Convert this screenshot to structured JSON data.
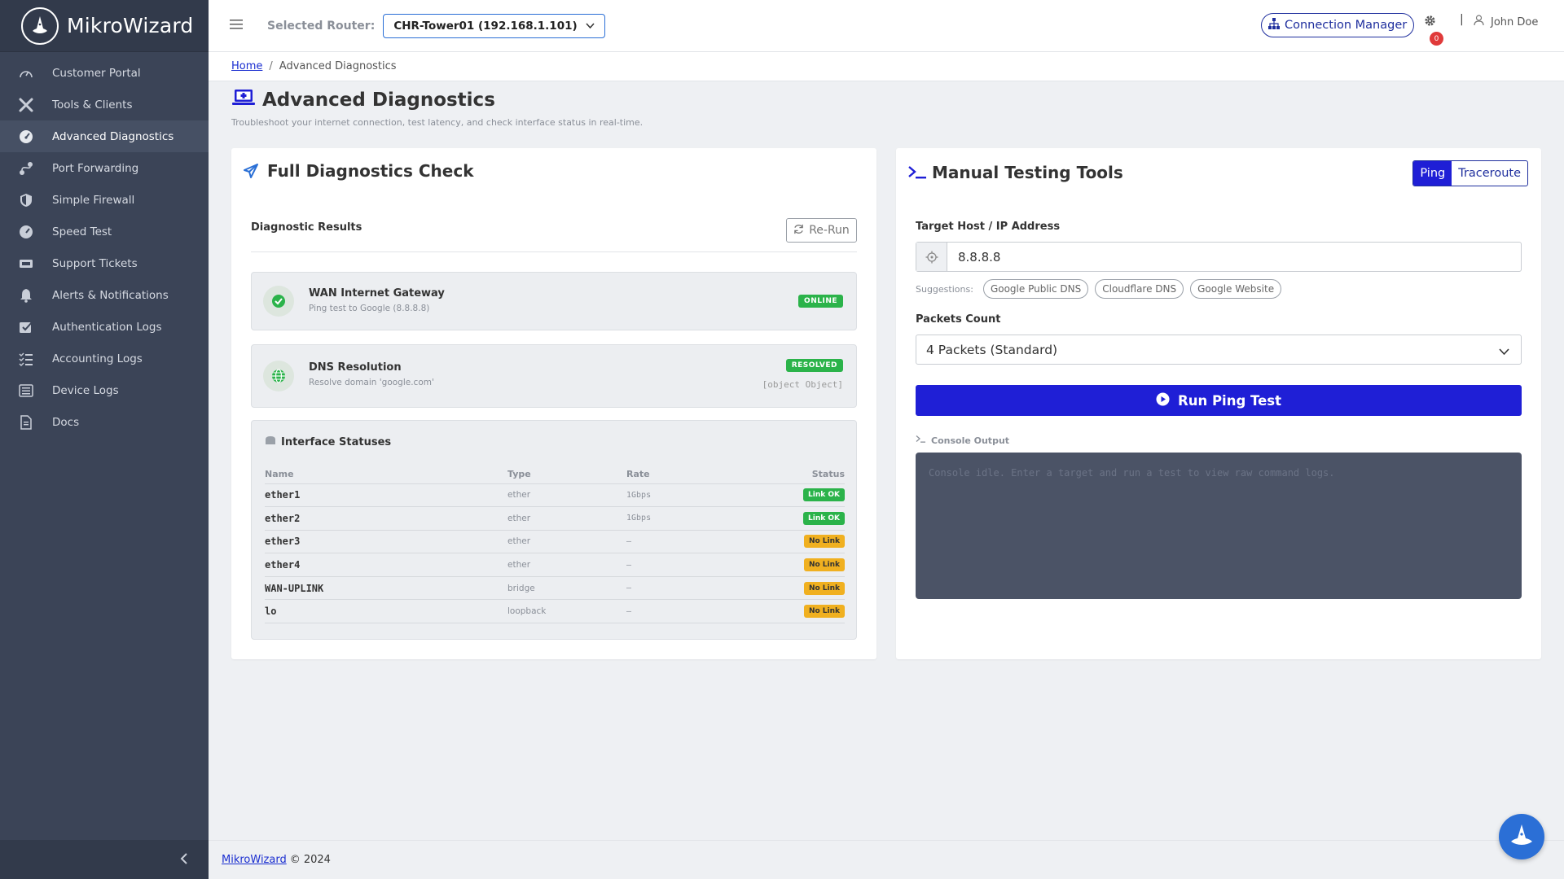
{
  "app": {
    "name": "MikroWizard"
  },
  "sidebar": {
    "items": [
      {
        "label": "Customer Portal",
        "icon": "gauge-icon"
      },
      {
        "label": "Tools & Clients",
        "icon": "tools-icon"
      },
      {
        "label": "Advanced Diagnostics",
        "icon": "speedometer-icon",
        "active": true
      },
      {
        "label": "Port Forwarding",
        "icon": "route-icon"
      },
      {
        "label": "Simple Firewall",
        "icon": "shield-icon"
      },
      {
        "label": "Speed Test",
        "icon": "speed-icon"
      },
      {
        "label": "Support Tickets",
        "icon": "ticket-icon"
      },
      {
        "label": "Alerts & Notifications",
        "icon": "bell-icon"
      },
      {
        "label": "Authentication Logs",
        "icon": "check-square-icon"
      },
      {
        "label": "Accounting Logs",
        "icon": "list-check-icon"
      },
      {
        "label": "Device Logs",
        "icon": "list-icon"
      },
      {
        "label": "Docs",
        "icon": "document-icon"
      }
    ]
  },
  "header": {
    "router_label": "Selected Router:",
    "router_value": "CHR-Tower01 (192.168.1.101)",
    "connection_manager": "Connection Manager",
    "notification_count": "0",
    "separator": "|",
    "user_name": "John Doe"
  },
  "breadcrumb": {
    "home": "Home",
    "separator": "/",
    "current": "Advanced Diagnostics"
  },
  "page": {
    "title": "Advanced Diagnostics",
    "subtitle": "Troubleshoot your internet connection, test latency, and check interface status in real-time."
  },
  "diagnostics": {
    "title": "Full Diagnostics Check",
    "results_label": "Diagnostic Results",
    "rerun_label": "Re-Run",
    "wan": {
      "title": "WAN Internet Gateway",
      "desc": "Ping test to Google (8.8.8.8)",
      "status": "ONLINE"
    },
    "dns": {
      "title": "DNS Resolution",
      "desc": "Resolve domain 'google.com'",
      "status": "RESOLVED",
      "detail": "[object Object]"
    },
    "interfaces": {
      "title": "Interface Statuses",
      "columns": {
        "name": "Name",
        "type": "Type",
        "rate": "Rate",
        "status": "Status"
      },
      "rows": [
        {
          "name": "ether1",
          "type": "ether",
          "rate": "1Gbps",
          "status": "Link OK",
          "ok": true
        },
        {
          "name": "ether2",
          "type": "ether",
          "rate": "1Gbps",
          "status": "Link OK",
          "ok": true
        },
        {
          "name": "ether3",
          "type": "ether",
          "rate": "—",
          "status": "No Link",
          "ok": false
        },
        {
          "name": "ether4",
          "type": "ether",
          "rate": "—",
          "status": "No Link",
          "ok": false
        },
        {
          "name": "WAN-UPLINK",
          "type": "bridge",
          "rate": "—",
          "status": "No Link",
          "ok": false
        },
        {
          "name": "lo",
          "type": "loopback",
          "rate": "—",
          "status": "No Link",
          "ok": false
        }
      ]
    }
  },
  "manual": {
    "title": "Manual Testing Tools",
    "tabs": {
      "ping": "Ping",
      "traceroute": "Traceroute"
    },
    "target_label": "Target Host / IP Address",
    "target_value": "8.8.8.8",
    "suggestions_label": "Suggestions:",
    "suggestions": [
      "Google Public DNS",
      "Cloudflare DNS",
      "Google Website"
    ],
    "packets_label": "Packets Count",
    "packets_value": "4 Packets (Standard)",
    "run_label": "Run Ping Test",
    "console_label": "Console Output",
    "console_placeholder": "Console idle. Enter a target and run a test to view raw command logs."
  },
  "footer": {
    "link": "MikroWizard",
    "text": "© 2024"
  },
  "colors": {
    "accent": "#1f1fd6",
    "sidebar": "#3b4457",
    "success": "#2bb34a",
    "warning": "#f0b020",
    "danger": "#e03a3a"
  }
}
